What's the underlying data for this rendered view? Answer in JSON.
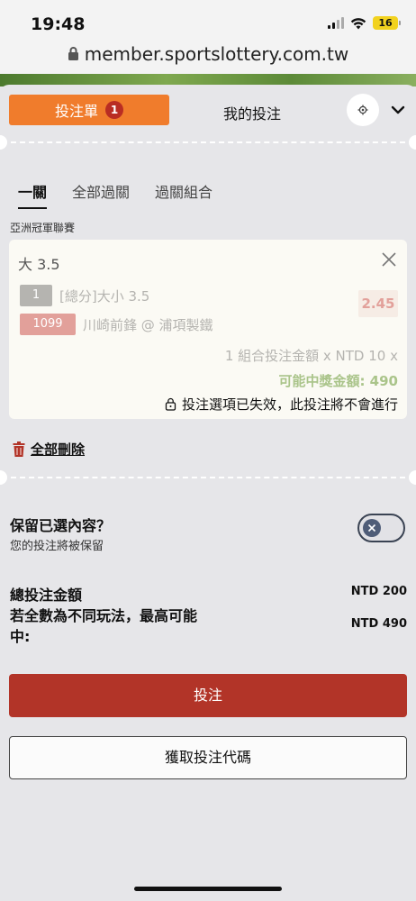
{
  "status_bar": {
    "time": "19:48",
    "battery": "16"
  },
  "browser": {
    "url": "member.sportslottery.com.tw"
  },
  "tabs": {
    "slip_label": "投注單",
    "slip_count": "1",
    "my_bets_label": "我的投注"
  },
  "icons": {
    "settings": "gear-icon",
    "collapse": "chevron-down-icon",
    "remove": "close-icon",
    "lock": "lock-icon",
    "delete": "trash-icon"
  },
  "bet_types": [
    "一關",
    "全部過關",
    "過關組合"
  ],
  "league": "亞洲冠軍聯賽",
  "bet": {
    "title": "大 3.5",
    "leg_number": "1",
    "market": "[總分]大小 3.5",
    "odds": "2.45",
    "match_number": "1099",
    "match": "川崎前鋒 @ 浦項製鐵",
    "stake_text": "1 組合投注金額 x NTD 10 x",
    "potential_win": "可能中獎金額: 490",
    "invalid_notice": "投注選項已失效，此投注將不會進行"
  },
  "delete_all": "全部刪除",
  "retain": {
    "title": "保留已選內容？",
    "subtitle": "您的投注將被保留"
  },
  "summary": {
    "total_label": "總投注金額",
    "total_value": "NTD 200",
    "max_label": "若全數為不同玩法，最高可能中:",
    "max_value": "NTD 490"
  },
  "buttons": {
    "place_bet": "投注",
    "get_code": "獲取投注代碼"
  },
  "colors": {
    "accent_orange": "#f07c2c",
    "primary_red": "#b23428",
    "badge_red": "#b92d23",
    "win_green": "#aac48a"
  }
}
